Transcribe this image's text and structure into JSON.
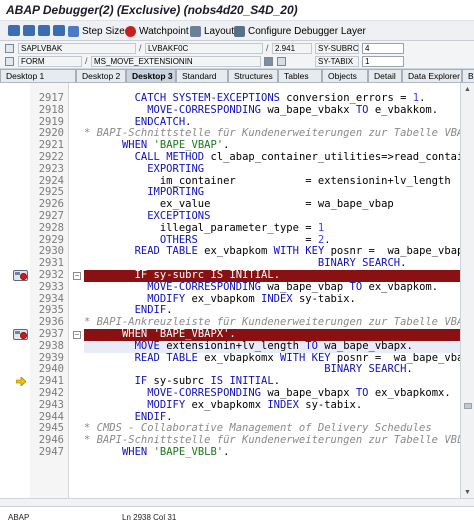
{
  "window": {
    "title": "ABAP Debugger(2)  (Exclusive) (nobs4d20_S4D_20)"
  },
  "toolbar": {
    "step_size_label": "Step Size",
    "watchpoint_label": "Watchpoint",
    "layout_label": "Layout",
    "configure_label": "Configure Debugger Layer"
  },
  "fields": {
    "row1": {
      "program": "SAPLVBAK",
      "include": "LVBAKF0C",
      "line": "2.941",
      "sysubrc_label": "SY-SUBRC",
      "sysubrc_value": "4"
    },
    "row2": {
      "type": "FORM",
      "routine": "MS_MOVE_EXTENSIONIN",
      "tabix_label": "SY-TABIX",
      "tabix_value": "1"
    }
  },
  "tabs": [
    "Desktop 1",
    "Desktop 2",
    "Desktop 3",
    "Standard",
    "Structures",
    "Tables",
    "Objects",
    "Detail",
    "Data Explorer",
    "Br"
  ],
  "active_tab": "Desktop 3",
  "code_lines": [
    {
      "n": "2917",
      "t": "        CATCH SYSTEM-EXCEPTIONS conversion_errors = 1."
    },
    {
      "n": "2918",
      "t": "          MOVE-CORRESPONDING wa_bape_vbakx TO e_vbakkom."
    },
    {
      "n": "2919",
      "t": "        ENDCATCH."
    },
    {
      "n": "2920",
      "t": "* BAPI-Schnittstelle für Kundenerweiterungen zur Tabelle VBAP"
    },
    {
      "n": "2921",
      "t": "      WHEN 'BAPE_VBAP'."
    },
    {
      "n": "2922",
      "t": "        CALL METHOD cl_abap_container_utilities=>read_container_c"
    },
    {
      "n": "2923",
      "t": "          EXPORTING"
    },
    {
      "n": "2924",
      "t": "            im_container           = extensionin+lv_length"
    },
    {
      "n": "2925",
      "t": "          IMPORTING"
    },
    {
      "n": "2926",
      "t": "            ex_value               = wa_bape_vbap"
    },
    {
      "n": "2927",
      "t": "          EXCEPTIONS"
    },
    {
      "n": "2928",
      "t": "            illegal_parameter_type = 1"
    },
    {
      "n": "2929",
      "t": "            OTHERS                 = 2."
    },
    {
      "n": "2930",
      "t": "        READ TABLE ex_vbapkom WITH KEY posnr =  wa_bape_vbap-posnr"
    },
    {
      "n": "2931",
      "t": "                                     BINARY SEARCH."
    },
    {
      "n": "2932",
      "t": "        IF sy-subrc IS INITIAL."
    },
    {
      "n": "2933",
      "t": "          MOVE-CORRESPONDING wa_bape_vbap TO ex_vbapkom."
    },
    {
      "n": "2934",
      "t": "          MODIFY ex_vbapkom INDEX sy-tabix."
    },
    {
      "n": "2935",
      "t": "        ENDIF."
    },
    {
      "n": "2936",
      "t": "* BAPI-Ankreuzleiste für Kundenerweiterungen zur Tabelle VBAP"
    },
    {
      "n": "2937",
      "t": "      WHEN 'BAPE_VBAPX'."
    },
    {
      "n": "2938",
      "t": "        MOVE extensionin+lv_length TO wa_bape_vbapx."
    },
    {
      "n": "2939",
      "t": "        READ TABLE ex_vbapkomx WITH KEY posnr =  wa_bape_vbapx-posnr"
    },
    {
      "n": "2940",
      "t": "                                      BINARY SEARCH."
    },
    {
      "n": "2941",
      "t": "        IF sy-subrc IS INITIAL."
    },
    {
      "n": "2942",
      "t": "          MOVE-CORRESPONDING wa_bape_vbapx TO ex_vbapkomx."
    },
    {
      "n": "2943",
      "t": "          MODIFY ex_vbapkomx INDEX sy-tabix."
    },
    {
      "n": "2944",
      "t": "        ENDIF."
    },
    {
      "n": "2945",
      "t": "* CMDS - Collaborative Management of Delivery Schedules"
    },
    {
      "n": "2946",
      "t": "* BAPI-Schnittstelle für Kundenerweiterungen zur Tabelle VBLB"
    },
    {
      "n": "2947",
      "t": "      WHEN 'BAPE_VBLB'."
    }
  ],
  "breakpoint_lines": [
    "2932",
    "2937"
  ],
  "current_line": "2941",
  "highlighted_lines": [
    "2932",
    "2937"
  ],
  "soft_highlight_lines": [
    "2938"
  ],
  "fold_lines": [
    "2932",
    "2937"
  ],
  "status": {
    "language": "ABAP",
    "position": "Ln 2938 Col 31"
  },
  "colors": {
    "breakpoint_line": "#8a1111",
    "keyword": "#1010c0",
    "string": "#1b7a1b",
    "comment": "#8a8a8a"
  }
}
